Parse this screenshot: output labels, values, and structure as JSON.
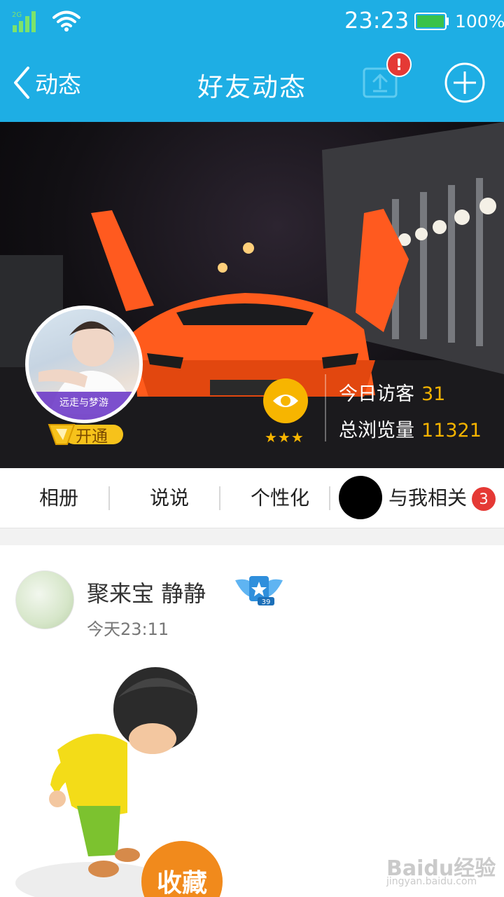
{
  "status_bar": {
    "time": "23:23",
    "battery": "100%",
    "battery_level": 1.0
  },
  "nav": {
    "back_label": "动态",
    "title": "好友动态",
    "notify_badge": "!"
  },
  "cover": {
    "avatar_tag": "远走与梦游",
    "vip_label": "开通",
    "rating_stars": "★★★",
    "visitors_label": "今日访客",
    "visitors_value": "31",
    "views_label": "总浏览量",
    "views_value": "11321"
  },
  "tabs": [
    {
      "label": "相册"
    },
    {
      "label": "说说"
    },
    {
      "label": "个性化"
    },
    {
      "label": "与我相关",
      "badge": "3"
    }
  ],
  "post": {
    "author": "聚来宝  静静",
    "time": "今天23:11",
    "level": "39",
    "image_caption": "收藏"
  },
  "watermark": {
    "brand": "Baidu经验",
    "url": "jingyan.baidu.com"
  },
  "colors": {
    "primary": "#1eaee4",
    "accent": "#f5b300",
    "badge": "#e53935"
  }
}
